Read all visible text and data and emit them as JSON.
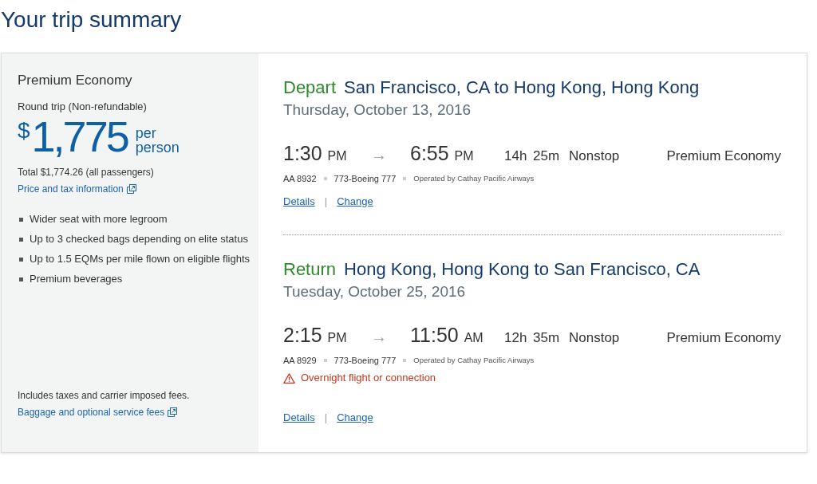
{
  "page_title": "Your trip summary",
  "fare_summary": {
    "cabin": "Premium Economy",
    "trip_type": "Round trip (Non-refundable)",
    "price": {
      "currency": "$",
      "amount": "1,775",
      "unit": "per person"
    },
    "total": "Total $1,774.26 (all passengers)",
    "price_link": "Price and tax information",
    "features": [
      "Wider seat with more legroom",
      "Up to 3 checked bags depending on elite status",
      "Up to 1.5 EQMs per mile flown on eligible flights",
      "Premium beverages"
    ],
    "fees_note": "Includes taxes and carrier imposed fees.",
    "fees_link": "Baggage and optional service fees"
  },
  "segments": [
    {
      "label": "Depart",
      "route": "San Francisco, CA to Hong Kong, Hong Kong",
      "date": "Thursday, October 13, 2016",
      "departure": {
        "time": "1:30",
        "period": "PM"
      },
      "arrow": "→",
      "arrival": {
        "time": "6:55",
        "period": "PM"
      },
      "duration": "14h 25m",
      "stops": "Nonstop",
      "cabin": "Premium Economy",
      "flight_number": "AA 8932",
      "aircraft": "773-Boeing 777",
      "operator": "Operated by Cathay Pacific Airways",
      "links": [
        "Details",
        "Change"
      ],
      "link_separator": "|"
    },
    {
      "label": "Return",
      "route": "Hong Kong, Hong Kong to San Francisco, CA",
      "date": "Tuesday, October 25, 2016",
      "departure": {
        "time": "2:15",
        "period": "PM"
      },
      "arrow": "→",
      "arrival": {
        "time": "11:50",
        "period": "AM"
      },
      "duration": "12h 35m",
      "stops": "Nonstop",
      "cabin": "Premium Economy",
      "flight_number": "AA 8929",
      "aircraft": "773-Boeing 777",
      "operator": "Operated by Cathay Pacific Airways",
      "warning": "Overnight flight or connection",
      "links": [
        "Details",
        "Change"
      ],
      "link_separator": "|"
    }
  ]
}
